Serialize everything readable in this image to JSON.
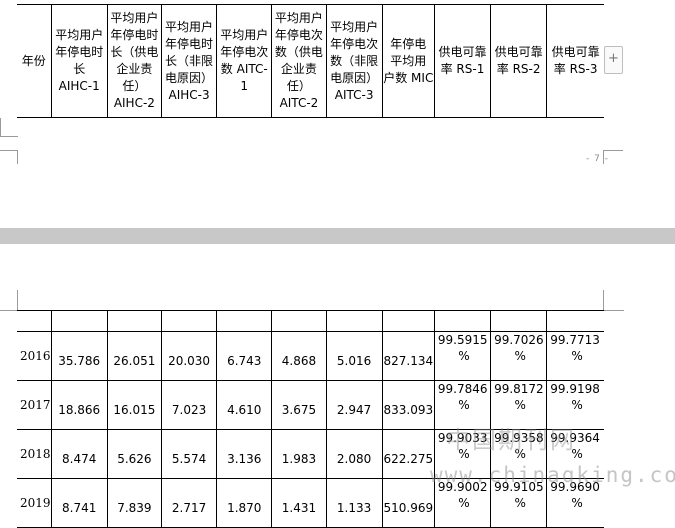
{
  "header": {
    "columns": [
      "年份",
      "平均用户\n年停电时\n长\nAIHC-1",
      "平均用户\n年停电时\n长（供电\n企业责\n任）\nAIHC-2",
      "平均用户\n年停电时\n长（非限\n电原因）\nAIHC-3",
      "平均用户\n年停电次\n数 AITC-1",
      "平均用户\n年停电次\n数（供电\n企业责\n任）\nAITC-2",
      "平均用户\n年停电次\n数（非限\n电原因）\nAITC-3",
      "年停电\n平均用\n户数 MIC",
      "供电可靠\n率 RS-1",
      "供电可靠\n率 RS-2",
      "供电可靠\n率 RS-3"
    ]
  },
  "rows": [
    {
      "year": "2016",
      "aihc1": "35.786",
      "aihc2": "26.051",
      "aihc3": "20.030",
      "aitc1": "6.743",
      "aitc2": "4.868",
      "aitc3": "5.016",
      "mic": "827.134",
      "rs1": "99.5915",
      "rs2": "99.7026",
      "rs3": "99.7713"
    },
    {
      "year": "2017",
      "aihc1": "18.866",
      "aihc2": "16.015",
      "aihc3": "7.023",
      "aitc1": "4.610",
      "aitc2": "3.675",
      "aitc3": "2.947",
      "mic": "833.093",
      "rs1": "99.7846",
      "rs2": "99.8172",
      "rs3": "99.9198"
    },
    {
      "year": "2018",
      "aihc1": "8.474",
      "aihc2": "5.626",
      "aihc3": "5.574",
      "aitc1": "3.136",
      "aitc2": "1.983",
      "aitc3": "2.080",
      "mic": "622.275",
      "rs1": "99.9033",
      "rs2": "99.9358",
      "rs3": "99.9364"
    },
    {
      "year": "2019",
      "aihc1": "8.741",
      "aihc2": "7.839",
      "aihc3": "2.717",
      "aitc1": "1.870",
      "aitc2": "1.431",
      "aitc3": "1.133",
      "mic": "510.969",
      "rs1": "99.9002",
      "rs2": "99.9105",
      "rs3": "99.9690"
    }
  ],
  "percent_sign": "%",
  "plus_button": "+",
  "page_number": "- 7 -",
  "watermark": {
    "cn": "中国期刊网",
    "url": "www.chinaqking.com"
  },
  "colors": {
    "page_gap": "#c8c8c8",
    "watermark": "#8c8c8c"
  }
}
